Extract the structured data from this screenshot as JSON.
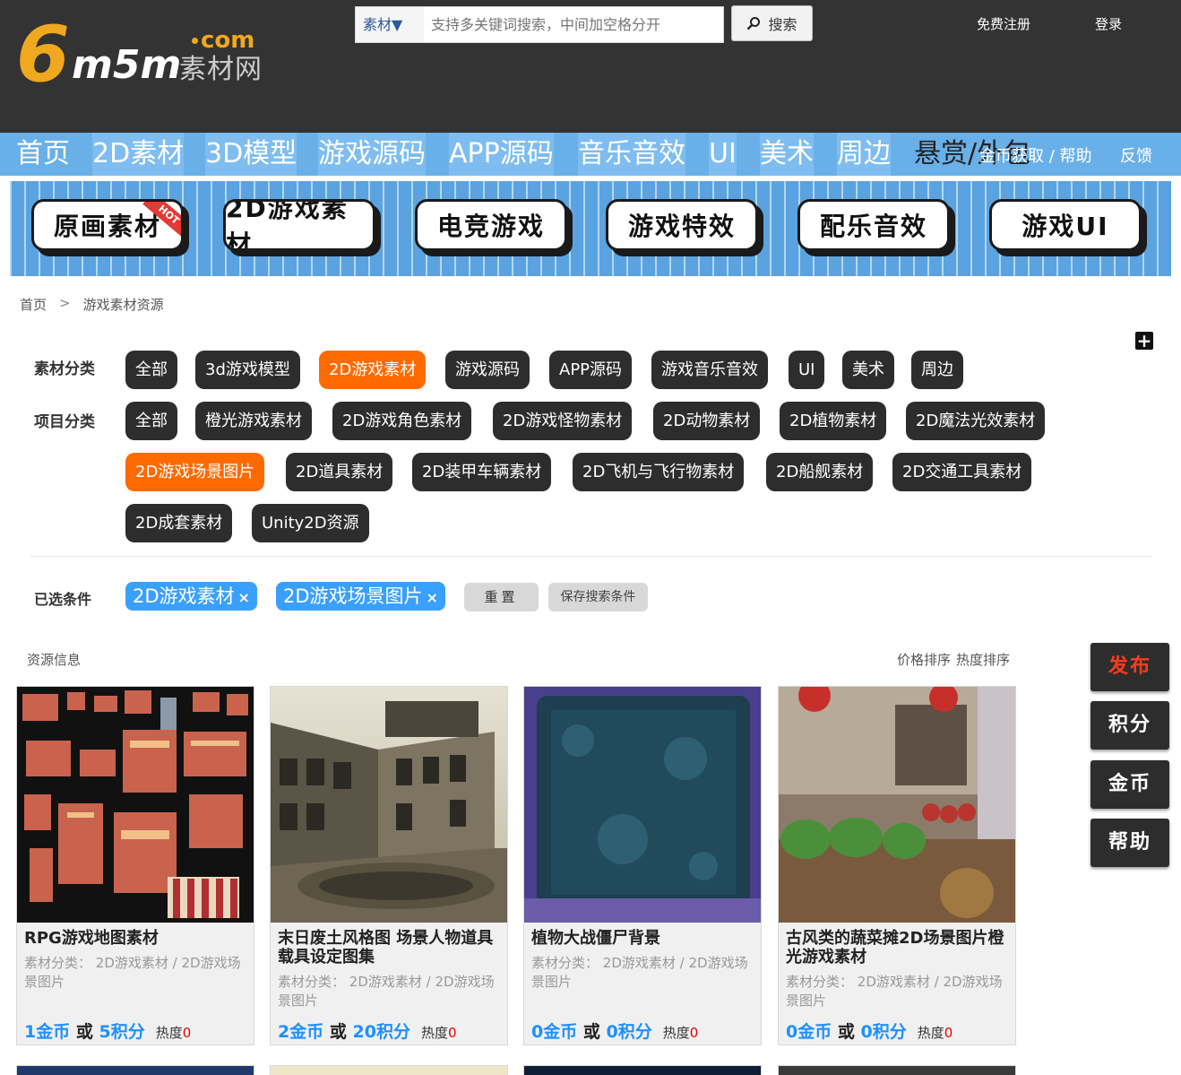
{
  "header": {
    "logo_six": "6",
    "logo_m5m": "m5m",
    "logo_com": "com",
    "logo_cn": "素材网",
    "search_type": "素材▼",
    "search_placeholder": "支持多关键词搜索，中间加空格分开",
    "search_button": "搜索",
    "register": "免费注册",
    "login": "登录"
  },
  "nav": {
    "items": [
      "首页",
      "2D素材",
      "3D模型",
      "游戏源码",
      "APP源码",
      "音乐音效",
      "UI",
      "美术",
      "周边",
      "悬赏/外包"
    ],
    "coins_help": "金币获取 / 帮助",
    "feedback": "反馈"
  },
  "banner": {
    "buttons": [
      "原画素材",
      "2D游戏素材",
      "电竞游戏",
      "游戏特效",
      "配乐音效",
      "游戏UI"
    ],
    "hot": "HOT"
  },
  "breadcrumb": {
    "home": "首页",
    "sep": ">",
    "current": "游戏素材资源"
  },
  "filters": {
    "category_label": "素材分类",
    "categories": [
      "全部",
      "3d游戏模型",
      "2D游戏素材",
      "游戏源码",
      "APP源码",
      "游戏音乐音效",
      "UI",
      "美术",
      "周边"
    ],
    "project_label": "项目分类",
    "projects": [
      "全部",
      "橙光游戏素材",
      "2D游戏角色素材",
      "2D游戏怪物素材",
      "2D动物素材",
      "2D植物素材",
      "2D魔法光效素材",
      "2D游戏场景图片",
      "2D道具素材",
      "2D装甲车辆素材",
      "2D飞机与飞行物素材",
      "2D船舰素材",
      "2D交通工具素材",
      "2D成套素材",
      "Unity2D资源"
    ],
    "selected_label": "已选条件",
    "selected": [
      "2D游戏素材",
      "2D游戏场景图片"
    ],
    "remove": "×",
    "reset": "重置",
    "save": "保存搜索条件"
  },
  "results": {
    "title": "资源信息",
    "sort_price": "价格排序",
    "sort_heat": "热度排序",
    "cat_prefix": "素材分类：",
    "or": "或",
    "heat_label": "热度",
    "cards": [
      {
        "title": "RPG游戏地图素材",
        "category": "2D游戏素材 / 2D游戏场景图片",
        "gold": "1金币",
        "points": "5积分",
        "heat": "0"
      },
      {
        "title": "末日废土风格图 场景人物道具载具设定图集",
        "category": "2D游戏素材 / 2D游戏场景图片",
        "gold": "2金币",
        "points": "20积分",
        "heat": "0"
      },
      {
        "title": "植物大战僵尸背景",
        "category": "2D游戏素材 / 2D游戏场景图片",
        "gold": "0金币",
        "points": "0积分",
        "heat": "0"
      },
      {
        "title": "古风类的蔬菜摊2D场景图片橙光游戏素材",
        "category": "2D游戏素材 / 2D游戏场景图片",
        "gold": "0金币",
        "points": "0积分",
        "heat": "0"
      }
    ]
  },
  "side": {
    "publish": "发布",
    "points": "积分",
    "coins": "金币",
    "help": "帮助"
  },
  "colors": {
    "header_bg": "#333333",
    "nav_bg": "#6ab0e8",
    "accent_orange": "#ff6a00",
    "chip_blue": "#3aa0ff",
    "tag_dark": "#2d2d2d",
    "price_blue": "#1e90ff",
    "heat_red": "#e60000"
  }
}
